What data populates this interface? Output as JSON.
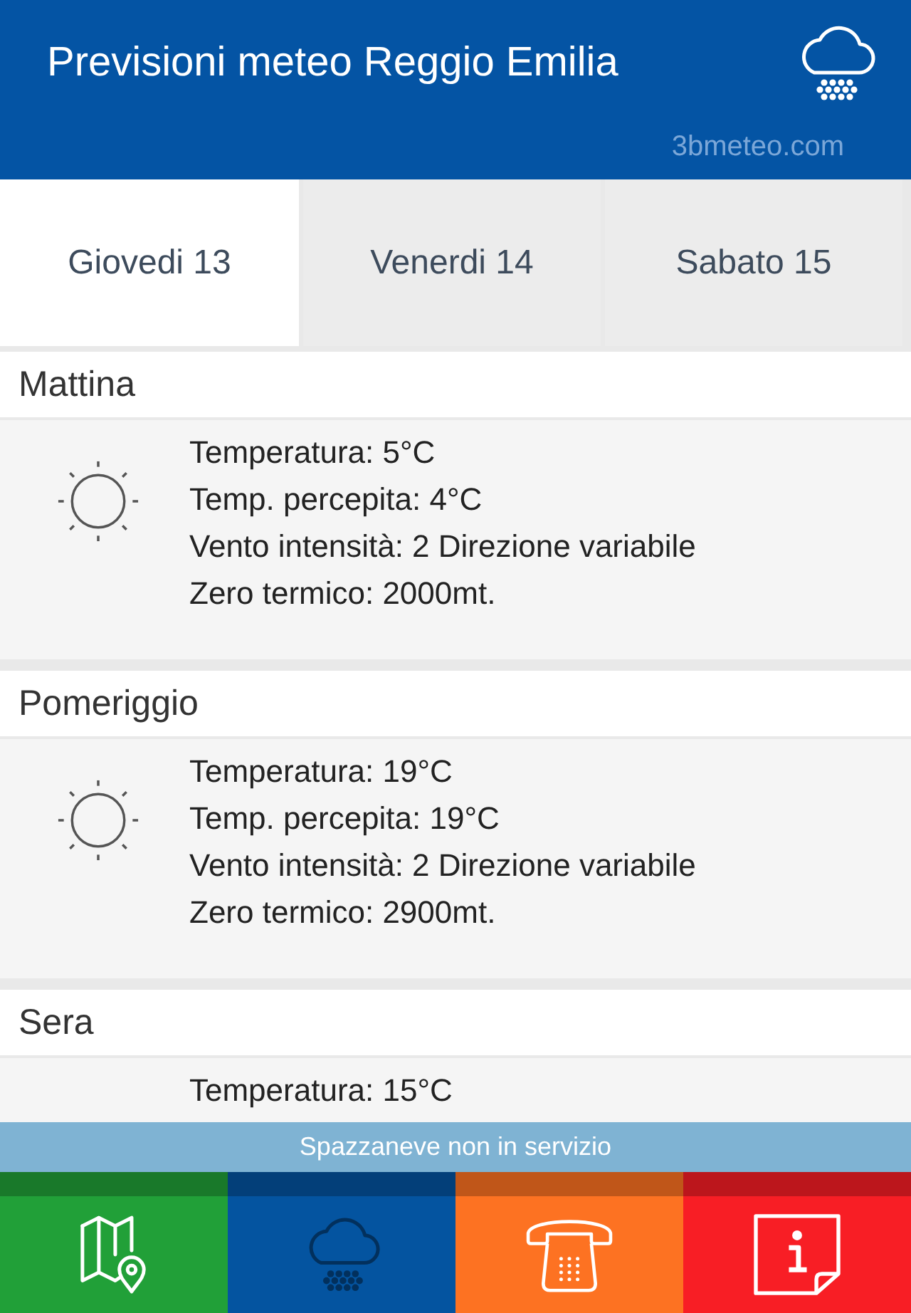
{
  "header": {
    "title": "Previsioni meteo Reggio Emilia",
    "source": "3bmeteo.com"
  },
  "day_tabs": [
    {
      "label": "Giovedi 13",
      "selected": true
    },
    {
      "label": "Venerdi 14",
      "selected": false
    },
    {
      "label": "Sabato 15",
      "selected": false
    }
  ],
  "periods": [
    {
      "name": "Mattina",
      "lines": [
        "Temperatura: 5°C",
        "Temp. percepita: 4°C",
        "Vento intensità: 2 Direzione variabile",
        "Zero termico: 2000mt."
      ]
    },
    {
      "name": "Pomeriggio",
      "lines": [
        "Temperatura: 19°C",
        "Temp. percepita: 19°C",
        "Vento intensità: 2 Direzione variabile",
        "Zero termico: 2900mt."
      ]
    },
    {
      "name": "Sera",
      "lines": [
        "Temperatura: 15°C"
      ]
    }
  ],
  "status_banner": {
    "text": "Spazzaneve non in servizio"
  },
  "bottom_nav": [
    {
      "kind": "map",
      "color": "#21a038",
      "selected": false
    },
    {
      "kind": "weather",
      "color": "#0454a0",
      "selected": true
    },
    {
      "kind": "phone",
      "color": "#fd7222",
      "selected": false
    },
    {
      "kind": "info",
      "color": "#f81e25",
      "selected": false
    }
  ]
}
